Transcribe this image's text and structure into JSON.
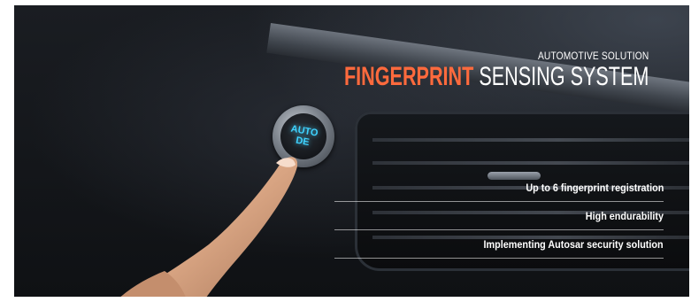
{
  "banner": {
    "kicker": "AUTOMOTIVE SOLUTION",
    "title_accent": "FINGERPRINT",
    "title_rest": " SENSING SYSTEM",
    "accent_color": "#ff6a3d",
    "start_button": {
      "line1": "AUTO",
      "line2": "DE"
    },
    "features": [
      "Up to 6 fingerprint registration",
      "High endurability",
      "Implementing Autosar security solution"
    ]
  }
}
